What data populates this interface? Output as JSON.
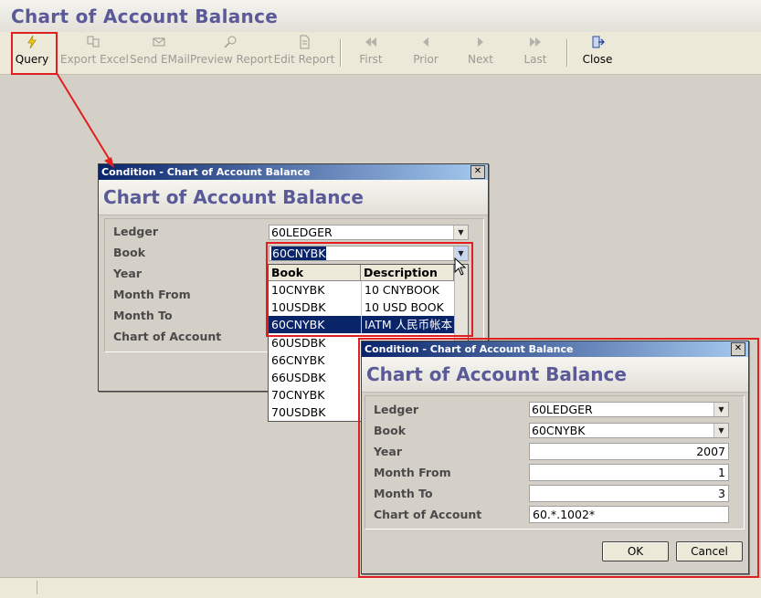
{
  "app": {
    "title": "Chart of Account Balance"
  },
  "toolbar": {
    "query": "Query",
    "export_excel": "Export Excel",
    "send_email": "Send EMail",
    "preview_report": "Preview Report",
    "edit_report": "Edit Report",
    "first": "First",
    "prior": "Prior",
    "next": "Next",
    "last": "Last",
    "close": "Close"
  },
  "dialog1": {
    "titlebar": "Condition - Chart of Account Balance",
    "heading": "Chart of Account Balance",
    "labels": {
      "ledger": "Ledger",
      "book": "Book",
      "year": "Year",
      "month_from": "Month From",
      "month_to": "Month To",
      "chart_of_account": "Chart of Account"
    },
    "ledger_value": "60LEDGER",
    "book_value": "60CNYBK",
    "dropdown": {
      "headers": [
        "Book",
        "Description"
      ],
      "rows": [
        {
          "book": "10CNYBK",
          "desc": "10 CNYBOOK"
        },
        {
          "book": "10USDBK",
          "desc": "10 USD BOOK"
        },
        {
          "book": "60CNYBK",
          "desc": "IATM 人民币帐本"
        },
        {
          "book": "60USDBK",
          "desc": ""
        },
        {
          "book": "66CNYBK",
          "desc": ""
        },
        {
          "book": "66USDBK",
          "desc": ""
        },
        {
          "book": "70CNYBK",
          "desc": ""
        },
        {
          "book": "70USDBK",
          "desc": ""
        }
      ],
      "selected": "60CNYBK"
    }
  },
  "dialog2": {
    "titlebar": "Condition - Chart of Account Balance",
    "heading": "Chart of Account Balance",
    "labels": {
      "ledger": "Ledger",
      "book": "Book",
      "year": "Year",
      "month_from": "Month From",
      "month_to": "Month To",
      "chart_of_account": "Chart of Account"
    },
    "ledger_value": "60LEDGER",
    "book_value": "60CNYBK",
    "year_value": "2007",
    "month_from_value": "1",
    "month_to_value": "3",
    "chart_of_account_value": "60.*.1002*",
    "ok": "OK",
    "cancel": "Cancel"
  },
  "colors": {
    "accent_title": "#5a5a98",
    "highlight": "#e02020",
    "selection": "#0a246a"
  },
  "icons": {
    "query": "lightning-icon",
    "close": "exit-door-icon"
  }
}
